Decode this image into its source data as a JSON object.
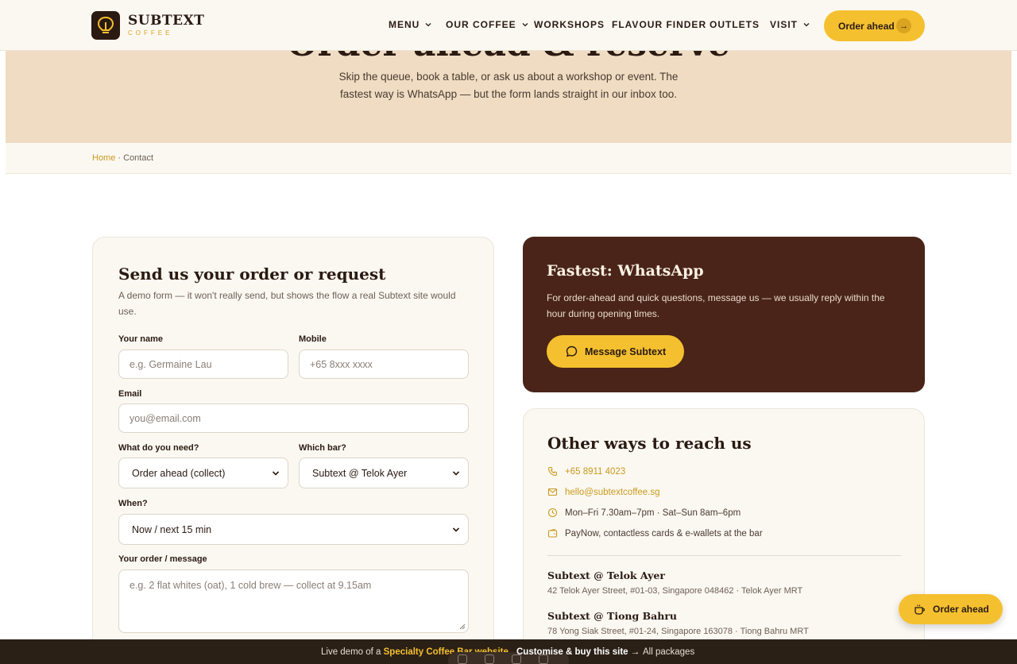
{
  "brand": {
    "name": "SUBTEXT",
    "tagline": "COFFEE"
  },
  "nav": {
    "items": [
      {
        "label": "MENU",
        "dropdown": true
      },
      {
        "label": "OUR COFFEE",
        "dropdown": true
      },
      {
        "label": "WORKSHOPS",
        "dropdown": false
      },
      {
        "label": "FLAVOUR FINDER",
        "dropdown": false
      },
      {
        "label": "OUTLETS",
        "dropdown": false
      },
      {
        "label": "VISIT",
        "dropdown": true
      }
    ],
    "cta": "Order ahead"
  },
  "hero": {
    "title": "Order ahead & reserve",
    "subtitle": "Skip the queue, book a table, or ask us about a workshop or event. The fastest way is WhatsApp — but the form lands straight in our inbox too."
  },
  "breadcrumb": {
    "home": "Home",
    "separator": " · ",
    "current": "Contact"
  },
  "form": {
    "title": "Send us your order or request",
    "subtitle": "A demo form — it won't really send, but shows the flow a real Subtext site would use.",
    "name_label": "Your name",
    "name_placeholder": "e.g. Germaine Lau",
    "mobile_label": "Mobile",
    "mobile_placeholder": "+65 8xxx xxxx",
    "email_label": "Email",
    "email_placeholder": "you@email.com",
    "need_label": "What do you need?",
    "need_value": "Order ahead (collect)",
    "bar_label": "Which bar?",
    "bar_value": "Subtext @ Telok Ayer",
    "when_label": "When?",
    "when_value": "Now / next 15 min",
    "message_label": "Your order / message",
    "message_placeholder": "e.g. 2 flat whites (oat), 1 cold brew — collect at 9.15am"
  },
  "whatsapp": {
    "title": "Fastest: WhatsApp",
    "text": "For order-ahead and quick questions, message us — we usually reply within the hour during opening times.",
    "button": "Message Subtext"
  },
  "other_ways": {
    "title": "Other ways to reach us",
    "phone": "+65 8911 4023",
    "email": "hello@subtextcoffee.sg",
    "hours": "Mon–Fri 7.30am–7pm · Sat–Sun 8am–6pm",
    "payment": "PayNow, contactless cards & e-wallets at the bar",
    "locations": [
      {
        "name": "Subtext @ Telok Ayer",
        "address": "42 Telok Ayer Street, #01-03, Singapore 048462 · Telok Ayer MRT"
      },
      {
        "name": "Subtext @ Tiong Bahru",
        "address": "78 Yong Siak Street, #01-24, Singapore 163078 · Tiong Bahru MRT"
      }
    ]
  },
  "floating_cta": "Order ahead",
  "bottom_bar": {
    "prefix": "Live demo of a",
    "accent": "Specialty Coffee Bar website",
    "cta": "Customise & buy this site →",
    "all": "All packages"
  },
  "colors": {
    "accent": "#f5c02f",
    "dark": "#2a1a12",
    "hero_bg": "#efdcc2",
    "wa_bg": "#4a2419"
  }
}
